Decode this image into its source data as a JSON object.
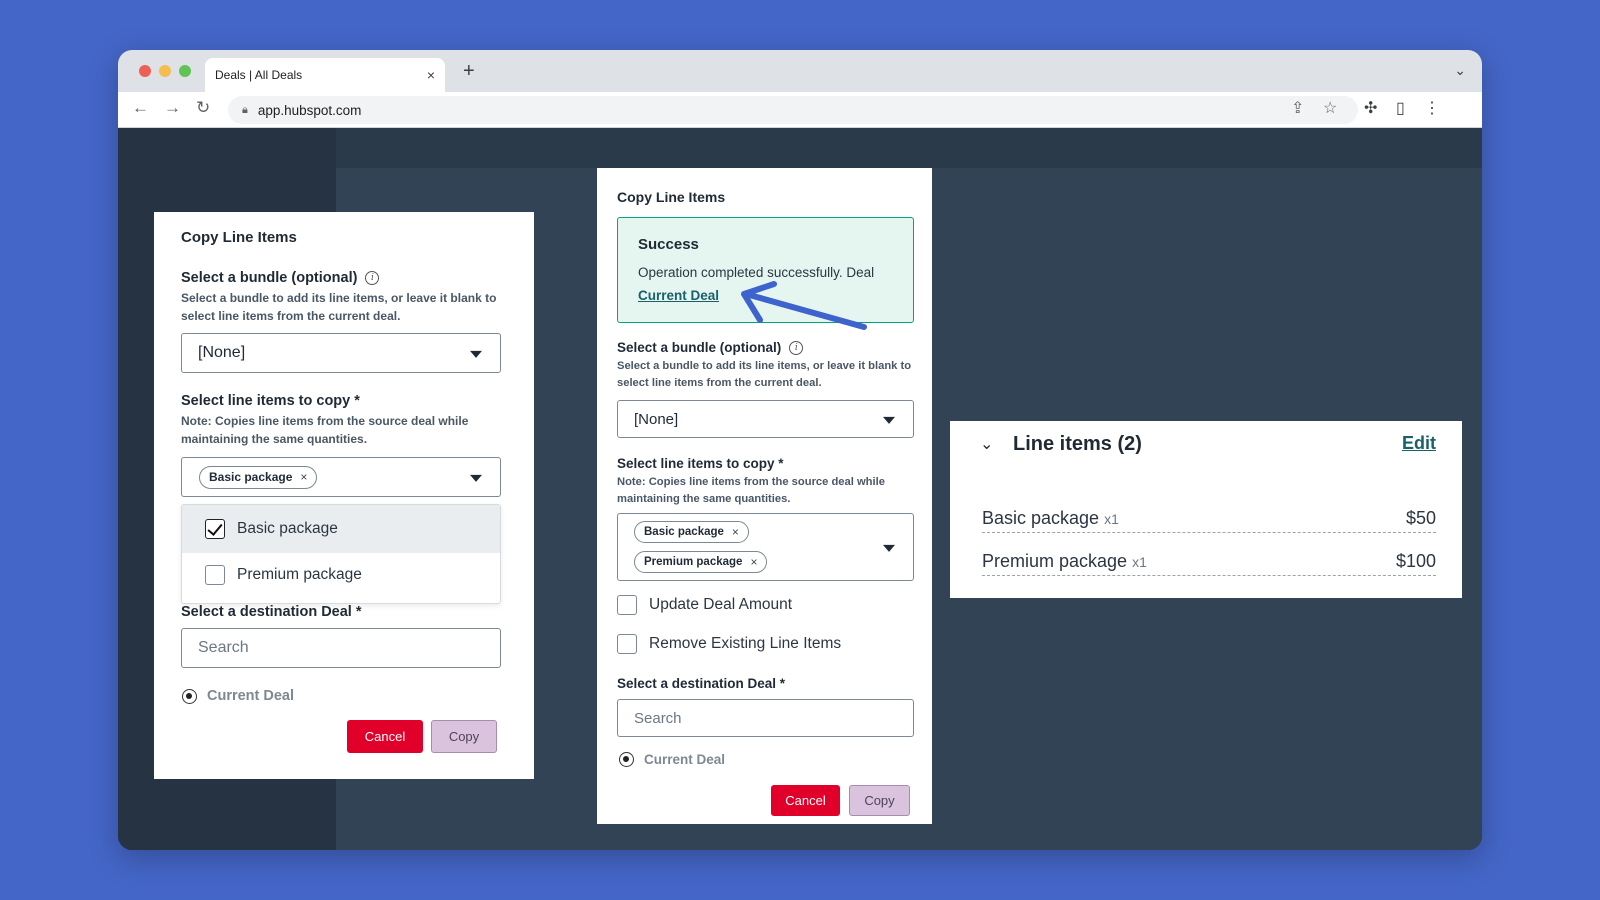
{
  "browser": {
    "tab_title": "Deals | All Deals",
    "tab_close": "×",
    "new_tab": "+",
    "url": "app.hubspot.com"
  },
  "left_dialog": {
    "title": "Copy Line Items",
    "bundle_label": "Select a bundle (optional)",
    "bundle_help": "Select a bundle to add its line items, or leave it blank to select line items from the current deal.",
    "bundle_value": "[None]",
    "items_label": "Select line items to copy *",
    "items_help": "Note: Copies line items from the source deal while maintaining the same quantities.",
    "selected_chips": [
      "Basic package"
    ],
    "options": [
      {
        "label": "Basic package",
        "checked": true
      },
      {
        "label": "Premium package",
        "checked": false
      }
    ],
    "dest_label": "Select a destination Deal *",
    "search_placeholder": "Search",
    "radio_label": "Current Deal",
    "cancel": "Cancel",
    "copy": "Copy"
  },
  "middle_dialog": {
    "title": "Copy Line Items",
    "success_title": "Success",
    "success_text": "Operation completed successfully. Deal",
    "success_link": "Current Deal",
    "bundle_label": "Select a bundle (optional)",
    "bundle_help": "Select a bundle to add its line items, or leave it blank to select line items from the current deal.",
    "bundle_value": "[None]",
    "items_label": "Select line items to copy *",
    "items_help": "Note: Copies line items from the source deal while maintaining the same quantities.",
    "selected_chips": [
      "Basic package",
      "Premium package"
    ],
    "update_amount": "Update Deal Amount",
    "remove_existing": "Remove Existing Line Items",
    "dest_label": "Select a destination Deal *",
    "search_placeholder": "Search",
    "radio_label": "Current Deal",
    "cancel": "Cancel",
    "copy": "Copy"
  },
  "line_items_card": {
    "title": "Line items (2)",
    "edit": "Edit",
    "items": [
      {
        "name": "Basic package",
        "qty": "x1",
        "price": "$50"
      },
      {
        "name": "Premium package",
        "qty": "x1",
        "price": "$100"
      }
    ]
  },
  "colors": {
    "background": "#4466c8",
    "cancel_button": "#e0002a",
    "copy_button": "#d9c3dd",
    "success_border": "#00a37a",
    "success_bg": "#e5f5f0",
    "link": "#1a6068",
    "arrow": "#3f63cc"
  }
}
